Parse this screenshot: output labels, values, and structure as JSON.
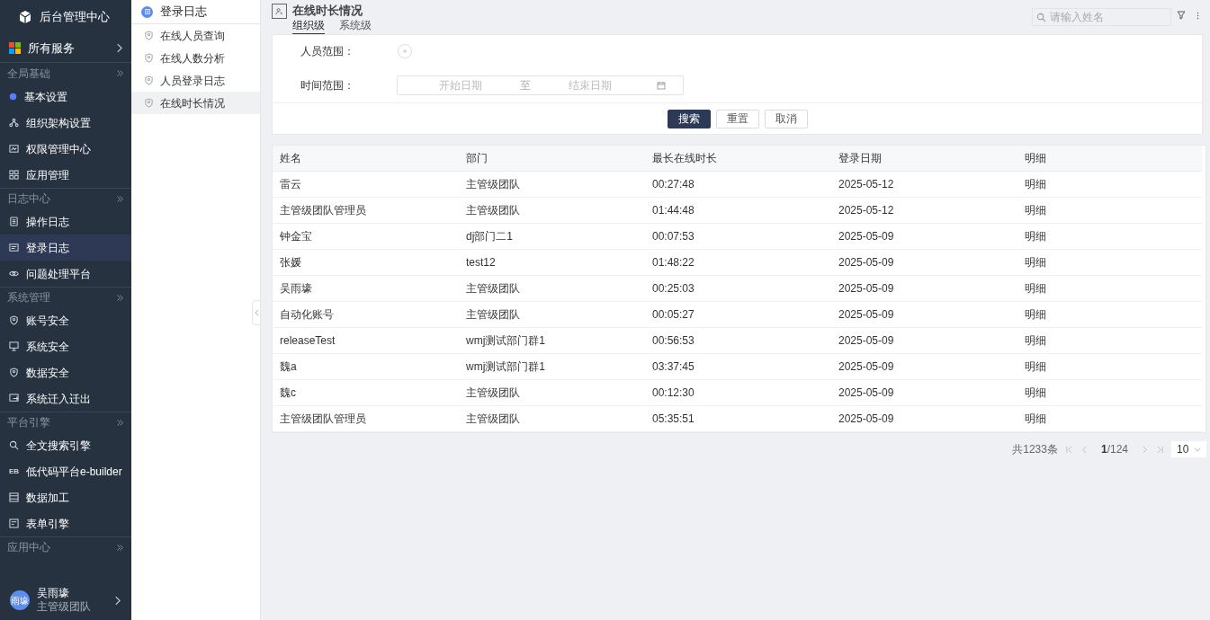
{
  "app": {
    "title": "后台管理中心",
    "all_services": "所有服务"
  },
  "sidebar": [
    {
      "title": "全局基础",
      "items": [
        {
          "label": "基本设置",
          "selected": false
        },
        {
          "label": "组织架构设置",
          "selected": false
        },
        {
          "label": "权限管理中心",
          "selected": false
        },
        {
          "label": "应用管理",
          "selected": false
        }
      ]
    },
    {
      "title": "日志中心",
      "items": [
        {
          "label": "操作日志",
          "selected": false
        },
        {
          "label": "登录日志",
          "selected": true
        },
        {
          "label": "问题处理平台",
          "selected": false
        }
      ]
    },
    {
      "title": "系统管理",
      "items": [
        {
          "label": "账号安全",
          "selected": false
        },
        {
          "label": "系统安全",
          "selected": false
        },
        {
          "label": "数据安全",
          "selected": false
        },
        {
          "label": "系统迁入迁出",
          "selected": false
        }
      ]
    },
    {
      "title": "平台引擎",
      "items": [
        {
          "label": "全文搜索引擎",
          "selected": false
        },
        {
          "label": "低代码平台e-builder",
          "selected": false,
          "badge": "EB"
        },
        {
          "label": "数据加工",
          "selected": false
        },
        {
          "label": "表单引擎",
          "selected": false
        }
      ]
    },
    {
      "title": "应用中心"
    }
  ],
  "user": {
    "avatar": "雨壕",
    "name": "吴雨壕",
    "dept": "主管级团队"
  },
  "submenu": {
    "title": "登录日志",
    "items": [
      {
        "label": "在线人员查询",
        "selected": false
      },
      {
        "label": "在线人数分析",
        "selected": false
      },
      {
        "label": "人员登录日志",
        "selected": false
      },
      {
        "label": "在线时长情况",
        "selected": true
      }
    ]
  },
  "page": {
    "title": "在线时长情况",
    "tabs": [
      {
        "label": "组织级",
        "selected": true
      },
      {
        "label": "系统级",
        "selected": false
      }
    ],
    "search": {
      "placeholder": "请输入姓名"
    }
  },
  "filters": {
    "person_label": "人员范围：",
    "time_label": "时间范围：",
    "start_placeholder": "开始日期",
    "separator": "至",
    "end_placeholder": "结束日期",
    "buttons": [
      {
        "label": "搜索",
        "kind": "primary"
      },
      {
        "label": "重置",
        "kind": "default"
      },
      {
        "label": "取消",
        "kind": "default"
      }
    ]
  },
  "table": {
    "columns": [
      "姓名",
      "部门",
      "最长在线时长",
      "登录日期",
      "明细"
    ],
    "rows": [
      [
        "雷云",
        "主管级团队",
        "00:27:48",
        "2025-05-12",
        "明细"
      ],
      [
        "主管级团队管理员",
        "主管级团队",
        "01:44:48",
        "2025-05-12",
        "明细"
      ],
      [
        "钟金宝",
        "dj部门二1",
        "00:07:53",
        "2025-05-09",
        "明细"
      ],
      [
        "张媛",
        "test12",
        "01:48:22",
        "2025-05-09",
        "明细"
      ],
      [
        "吴雨壕",
        "主管级团队",
        "00:25:03",
        "2025-05-09",
        "明细"
      ],
      [
        "自动化账号",
        "主管级团队",
        "00:05:27",
        "2025-05-09",
        "明细"
      ],
      [
        "releaseTest",
        "wmj测试部门群1",
        "00:56:53",
        "2025-05-09",
        "明细"
      ],
      [
        "魏a",
        "wmj测试部门群1",
        "03:37:45",
        "2025-05-09",
        "明细"
      ],
      [
        "魏c",
        "主管级团队",
        "00:12:30",
        "2025-05-09",
        "明细"
      ],
      [
        "主管级团队管理员",
        "主管级团队",
        "05:35:51",
        "2025-05-09",
        "明细"
      ]
    ]
  },
  "pagination": {
    "total": "共1233条",
    "current": "1",
    "pages": "/124",
    "page_size": "10"
  }
}
